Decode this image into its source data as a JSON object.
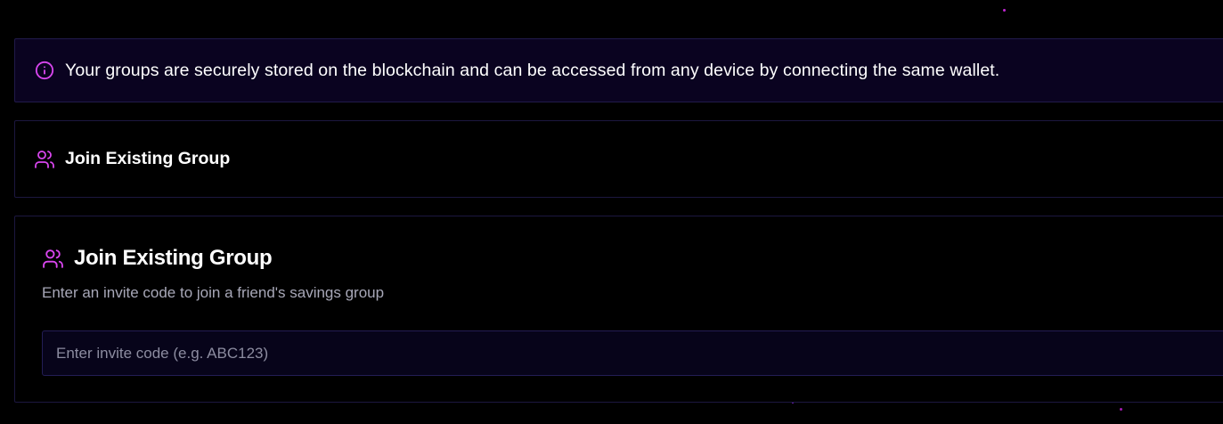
{
  "info_banner": {
    "icon": "info-circle-icon",
    "text": "Your groups are securely stored on the blockchain and can be accessed from any device by connecting the same wallet."
  },
  "collapsed_section": {
    "icon": "users-icon",
    "title": "Join Existing Group"
  },
  "join_card": {
    "icon": "users-icon",
    "title": "Join Existing Group",
    "subtitle": "Enter an invite code to join a friend's savings group",
    "input": {
      "value": "",
      "placeholder": "Enter invite code (e.g. ABC123)"
    }
  },
  "colors": {
    "background": "#000000",
    "accent": "#d946ef",
    "banner_bg": "#0a0320",
    "border": "#1c1740"
  }
}
